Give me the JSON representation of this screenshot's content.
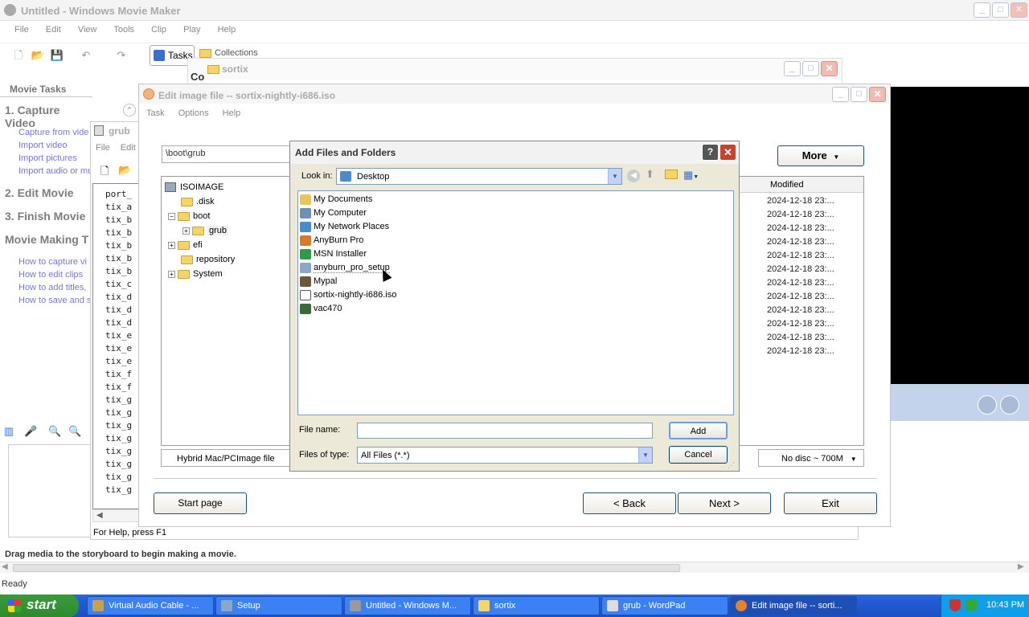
{
  "movie_maker": {
    "title": "Untitled - Windows Movie Maker",
    "menu": [
      "File",
      "Edit",
      "View",
      "Tools",
      "Clip",
      "Play",
      "Help"
    ],
    "tasks_label": "Tasks",
    "collections_label": "Collections",
    "collections_combo": "Collections",
    "movie_tasks_header": "Movie Tasks",
    "capture_header": "1. Capture Video",
    "capture_links": [
      "Capture from vide",
      "Import video",
      "Import pictures",
      "Import audio or mu"
    ],
    "edit_header": "2. Edit Movie",
    "finish_header": "3. Finish Movie",
    "tips_header": "Movie Making T",
    "tips_links": [
      "How to capture vi",
      "How to edit clips",
      "How to add titles,",
      "How to save and s"
    ],
    "storyboard_hint": "Drag media to the storyboard to begin making a movie.",
    "status": "Ready"
  },
  "sortix_window": {
    "title": "sortix",
    "partial_text": "Co"
  },
  "wordpad": {
    "title": "grub",
    "menu": [
      "File",
      "Edit"
    ],
    "status": "For Help, press F1",
    "lines": [
      "port_",
      "tix_a",
      "tix_b",
      "tix_b",
      "tix_b",
      "tix_b",
      "tix_b",
      "tix_c",
      "tix_d",
      "tix_d",
      "tix_d",
      "tix_e",
      "tix_e",
      "tix_e",
      "tix_f",
      "tix_f",
      "tix_g",
      "tix_g",
      "tix_g",
      "tix_g",
      "tix_g",
      "tix_g",
      "tix_g",
      "tix_g",
      "tix_g"
    ]
  },
  "anyburn": {
    "title": "Edit image file -- sortix-nightly-i686.iso",
    "menu": [
      "Task",
      "Options",
      "Help"
    ],
    "path": "\\boot\\grub",
    "more_button": "More",
    "tree": [
      {
        "label": "ISOIMAGE",
        "indent": 0,
        "expander": ""
      },
      {
        "label": ".disk",
        "indent": 1,
        "expander": ""
      },
      {
        "label": "boot",
        "indent": 1,
        "expander": "−"
      },
      {
        "label": "grub",
        "indent": 2,
        "expander": "+"
      },
      {
        "label": "efi",
        "indent": 1,
        "expander": "+"
      },
      {
        "label": "repository",
        "indent": 1,
        "expander": ""
      },
      {
        "label": "System",
        "indent": 1,
        "expander": "+"
      }
    ],
    "modified_header": "Modified",
    "modified_dates": [
      "2024-12-18 23:...",
      "2024-12-18 23:...",
      "2024-12-18 23:...",
      "2024-12-18 23:...",
      "2024-12-18 23:...",
      "2024-12-18 23:...",
      "2024-12-18 23:...",
      "2024-12-18 23:...",
      "2024-12-18 23:...",
      "2024-12-18 23:...",
      "2024-12-18 23:...",
      "2024-12-18 23:..."
    ],
    "image_type": "Hybrid Mac/PCImage file",
    "disc_status": "No disc ~ 700M",
    "start_page_button": "Start page",
    "back_button": "< Back",
    "next_button": "Next >",
    "exit_button": "Exit"
  },
  "dialog": {
    "title": "Add Files and Folders",
    "help_glyph": "?",
    "look_in_label": "Look in:",
    "look_in_value": "Desktop",
    "items": [
      {
        "label": "My Documents",
        "icon": "my-documents-icon",
        "color": "#e9c65a"
      },
      {
        "label": "My Computer",
        "icon": "my-computer-icon",
        "color": "#6f8fb8"
      },
      {
        "label": "My Network Places",
        "icon": "network-places-icon",
        "color": "#4a8bd0"
      },
      {
        "label": "AnyBurn Pro",
        "icon": "shortcut-icon",
        "color": "#d97a2b"
      },
      {
        "label": "MSN Installer",
        "icon": "msn-icon",
        "color": "#2f9a4a"
      },
      {
        "label": "anyburn_pro_setup",
        "icon": "setup-icon",
        "color": "#8aa6c9"
      },
      {
        "label": "Mypal",
        "icon": "mypal-icon",
        "color": "#6b5a3a"
      },
      {
        "label": "sortix-nightly-i686.iso",
        "icon": "iso-file-icon",
        "color": "#9a9a9a"
      },
      {
        "label": "vac470",
        "icon": "vac470-icon",
        "color": "#3a6a3a"
      }
    ],
    "file_name_label": "File name:",
    "file_name_value": "",
    "file_type_label": "Files of type:",
    "file_type_value": "All Files (*.*)",
    "add_button": "Add",
    "cancel_button": "Cancel"
  },
  "taskbar": {
    "start_label": "start",
    "items": [
      {
        "label": "Virtual Audio Cable - ...",
        "color": "#c8a050",
        "active": false
      },
      {
        "label": "Setup",
        "color": "#8aa6c9",
        "active": false
      },
      {
        "label": "Untitled - Windows M...",
        "color": "#999999",
        "active": false
      },
      {
        "label": "sortix",
        "color": "#f5d56a",
        "active": false
      },
      {
        "label": "grub - WordPad",
        "color": "#dddddd",
        "active": false
      },
      {
        "label": "Edit image file -- sorti...",
        "color": "#e8822a",
        "active": true
      }
    ],
    "clock": "10:43 PM"
  }
}
